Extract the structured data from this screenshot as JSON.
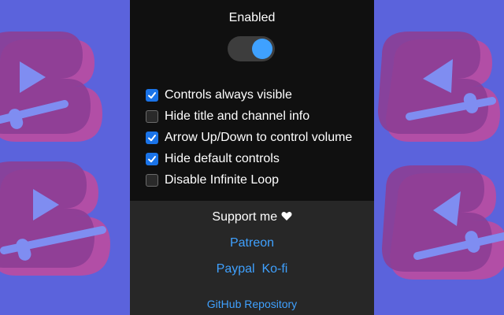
{
  "header": {
    "title": "Enabled"
  },
  "toggle": {
    "state": "on"
  },
  "options": [
    {
      "label": "Controls always visible",
      "checked": true
    },
    {
      "label": "Hide title and channel info",
      "checked": false
    },
    {
      "label": "Arrow Up/Down to control volume",
      "checked": true
    },
    {
      "label": "Hide default controls",
      "checked": true
    },
    {
      "label": "Disable Infinite Loop",
      "checked": false
    }
  ],
  "support": {
    "label": "Support me",
    "heart_icon": "heart-icon",
    "patreon": "Patreon",
    "paypal": "Paypal",
    "kofi": "Ko-fi",
    "github": "GitHub Repository"
  },
  "colors": {
    "background": "#5b63dc",
    "panel": "#101010",
    "footer": "#272727",
    "accent": "#3fa1ff",
    "checkbox": "#1a73e8",
    "logo": "#9c4fb3"
  }
}
